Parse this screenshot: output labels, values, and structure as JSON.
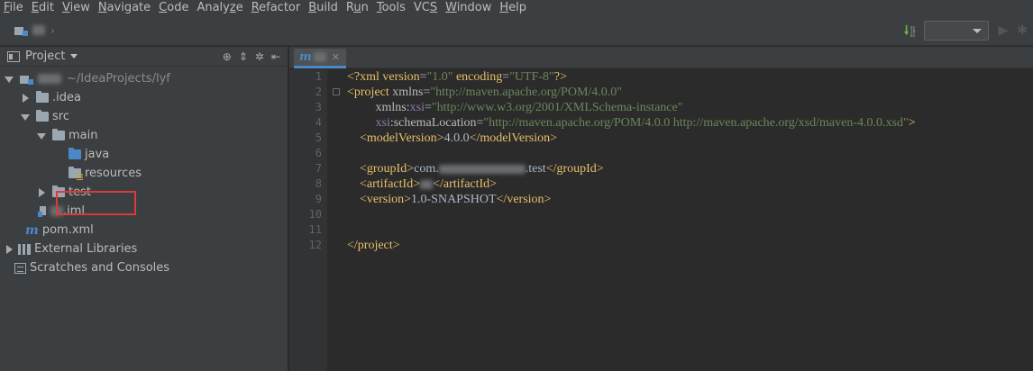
{
  "menubar": {
    "items": [
      {
        "mn": "F",
        "rest": "ile"
      },
      {
        "mn": "E",
        "rest": "dit"
      },
      {
        "mn": "V",
        "rest": "iew"
      },
      {
        "mn": "N",
        "rest": "avigate"
      },
      {
        "mn": "C",
        "rest": "ode"
      },
      {
        "pre": "Analy",
        "mn": "z",
        "rest": "e"
      },
      {
        "mn": "R",
        "rest": "efactor"
      },
      {
        "mn": "B",
        "rest": "uild"
      },
      {
        "pre": "R",
        "mn": "u",
        "rest": "n"
      },
      {
        "mn": "T",
        "rest": "ools"
      },
      {
        "pre": "VC",
        "mn": "S",
        "rest": ""
      },
      {
        "mn": "W",
        "rest": "indow"
      },
      {
        "mn": "H",
        "rest": "elp"
      }
    ]
  },
  "project_panel": {
    "title": "Project",
    "tree": {
      "root_path": "~/IdeaProjects/lyf",
      "idea": ".idea",
      "src": "src",
      "main": "main",
      "java": "java",
      "resources": "resources",
      "test": "test",
      "iml": ".iml",
      "pom": "pom.xml",
      "external_libraries": "External Libraries",
      "scratches": "Scratches and Consoles"
    }
  },
  "editor": {
    "line_numbers": [
      "1",
      "2",
      "3",
      "4",
      "5",
      "6",
      "7",
      "8",
      "9",
      "10",
      "11",
      "12"
    ],
    "code": {
      "l1_a": "<?xml version",
      "l1_b": "=",
      "l1_c": "\"1.0\"",
      "l1_d": " encoding",
      "l1_e": "=",
      "l1_f": "\"UTF-8\"",
      "l1_g": "?>",
      "l2_tag": "<project",
      "l2_attr": " xmlns",
      "l2_eq": "=",
      "l2_val": "\"http://maven.apache.org/POM/4.0.0\"",
      "l3_attr": "         xmlns:",
      "l3_ns": "xsi",
      "l3_eq": "=",
      "l3_val": "\"http://www.w3.org/2001/XMLSchema-instance\"",
      "l4_ns": "         xsi",
      "l4_attr": ":schemaLocation",
      "l4_eq": "=",
      "l4_val": "\"http://maven.apache.org/POM/4.0.0 http://maven.apache.org/xsd/maven-4.0.0.xsd\"",
      "l4_end": ">",
      "l5_open": "    <modelVersion>",
      "l5_text": "4.0.0",
      "l5_close": "</modelVersion>",
      "l7_open": "    <groupId>",
      "l7_text_a": "com.",
      "l7_text_b": ".test",
      "l7_close": "</groupId>",
      "l8_open": "    <artifactId>",
      "l8_close": "</artifactId>",
      "l9_open": "    <version>",
      "l9_text": "1.0-SNAPSHOT",
      "l9_close": "</version>",
      "l12_close": "</project>"
    }
  }
}
